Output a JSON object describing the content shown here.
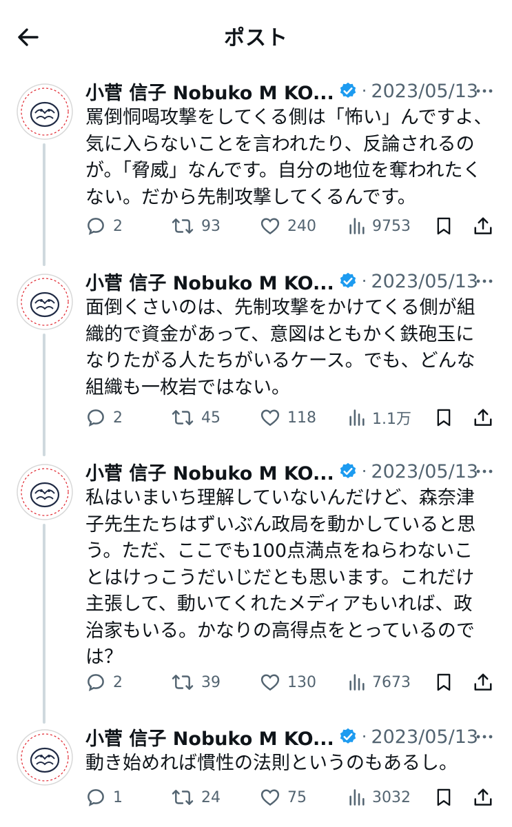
{
  "header": {
    "title": "ポスト"
  },
  "author": {
    "name": "小菅 信子 Nobuko M KO...",
    "separator": "·"
  },
  "colors": {
    "verified": "#1d9bf0",
    "muted": "#536471",
    "thread_line": "#cfd9de"
  },
  "tweets": [
    {
      "date": "2023/05/13",
      "text": "罵倒恫喝攻撃をしてくる側は「怖い」んですよ、\n気に入らないことを言われたり、反論されるの\nが。「脅威」なんです。自分の地位を奪われたく\nない。だから先制攻撃してくるんです。",
      "replies": "2",
      "reposts": "93",
      "likes": "240",
      "views": "9753"
    },
    {
      "date": "2023/05/13",
      "text": "面倒くさいのは、先制攻撃をかけてくる側が組\n織的で資金があって、意図はともかく鉄砲玉に\nなりたがる人たちがいるケース。でも、どんな\n組織も一枚岩ではない。",
      "replies": "2",
      "reposts": "45",
      "likes": "118",
      "views": "1.1万"
    },
    {
      "date": "2023/05/13",
      "text": "私はいまいち理解していないんだけど、森奈津\n子先生たちはずいぶん政局を動かしていると思\nう。ただ、ここでも100点満点をねらわないこ\nとはけっこうだいじだとも思います。これだけ\n主張して、動いてくれたメディアもいれば、政\n治家もいる。かなりの高得点をとっているので\nは？",
      "replies": "2",
      "reposts": "39",
      "likes": "130",
      "views": "7673"
    },
    {
      "date": "2023/05/13",
      "text": "動き始めれば慣性の法則というのもあるし。",
      "replies": "1",
      "reposts": "24",
      "likes": "75",
      "views": "3032"
    }
  ]
}
